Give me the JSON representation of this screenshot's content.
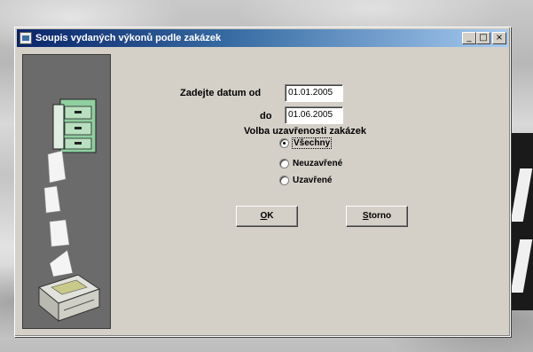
{
  "window": {
    "title": "Soupis vydaných výkonů podle zakázek",
    "buttons": {
      "minimize": "_",
      "maximize": "□",
      "close": "×"
    }
  },
  "form": {
    "date_from_label": "Zadejte datum od",
    "date_from_value": "01.01.2005",
    "date_to_label": "do",
    "date_to_value": "01.06.2005",
    "closure_label": "Volba uzavřenosti zakázek",
    "options": [
      {
        "label": "Všechny",
        "checked": true
      },
      {
        "label": "Neuzavřené",
        "checked": false
      },
      {
        "label": "Uzavřené",
        "checked": false
      }
    ]
  },
  "buttons": {
    "ok_hotkey": "O",
    "ok_rest": "K",
    "cancel_hotkey": "S",
    "cancel_rest": "torno"
  },
  "icons": {
    "title": "application-icon",
    "illustration": "printer-illustration"
  }
}
